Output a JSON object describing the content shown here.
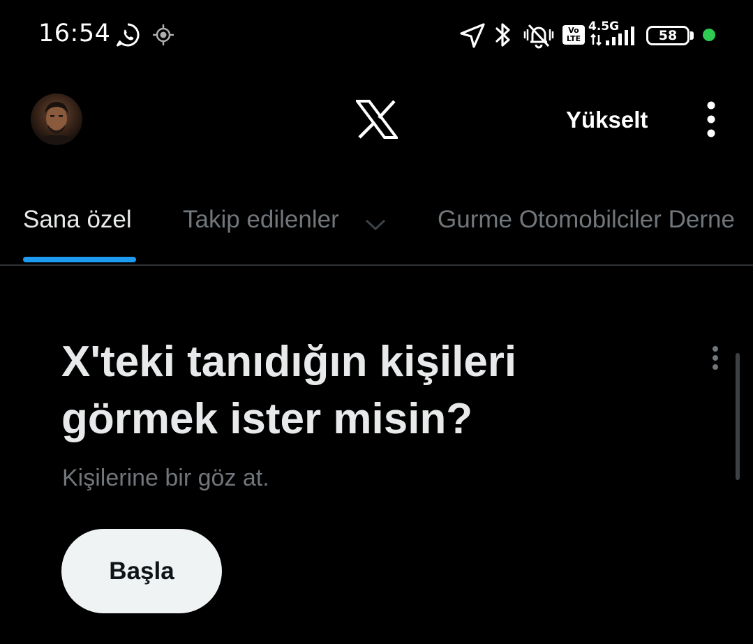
{
  "status_bar": {
    "time": "16:54",
    "network_label": "4.5G",
    "volte_line1": "Vo",
    "volte_line2": "LTE",
    "battery": "58",
    "icons": [
      "whatsapp-icon",
      "gps-target-icon",
      "location-arrow-icon",
      "bluetooth-icon",
      "notifications-muted-icon",
      "volte-icon",
      "signal-icon",
      "battery-icon",
      "active-dot-icon"
    ],
    "dot_color": "#2ecc52"
  },
  "header": {
    "avatar": "profile-avatar",
    "logo": "x-logo-icon",
    "upgrade_label": "Yükselt",
    "more_icon": "vertical-dots-icon"
  },
  "tabs": {
    "items": [
      {
        "label": "Sana özel",
        "active": true
      },
      {
        "label": "Takip edilenler",
        "active": false,
        "icon": "chevron-down-icon"
      },
      {
        "label": "Gurme Otomobilciler Derne",
        "active": false
      }
    ],
    "indicator_color": "#1d9bf0"
  },
  "card": {
    "title_line1": "X'teki tanıdığın kişileri",
    "title_line2": "görmek ister misin?",
    "subtitle": "Kişilerine bir göz at.",
    "button_label": "Başla",
    "more_icon": "vertical-dots-icon"
  }
}
